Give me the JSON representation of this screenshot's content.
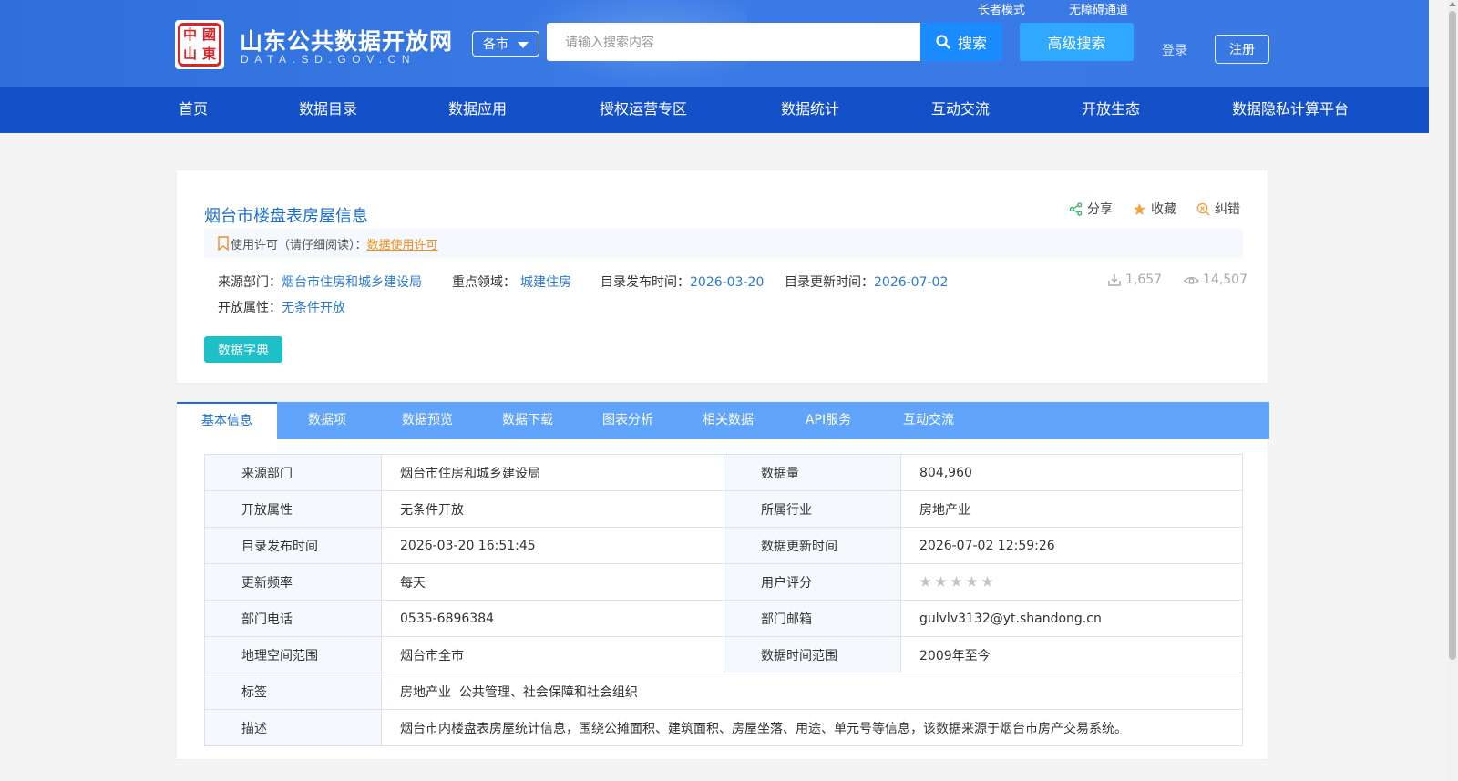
{
  "header": {
    "logo_text": [
      "中",
      "國",
      "山",
      "東"
    ],
    "site_title": "山东公共数据开放网",
    "site_subtitle": "DATA.SD.GOV.CN",
    "region_select": "各市",
    "search_placeholder": "请输入搜索内容",
    "search_button": "搜索",
    "advanced_search": "高级搜索",
    "elder_mode": "长者模式",
    "accessibility": "无障碍通道",
    "login": "登录",
    "register": "注册"
  },
  "nav": [
    "首页",
    "数据目录",
    "数据应用",
    "授权运营专区",
    "数据统计",
    "互动交流",
    "开放生态",
    "数据隐私计算平台"
  ],
  "dataset": {
    "title": "烟台市楼盘表房屋信息",
    "actions": {
      "share": "分享",
      "favorite": "收藏",
      "correct": "纠错"
    },
    "license_prefix": "使用许可（请仔细阅读）：",
    "license_link": "数据使用许可",
    "source_label": "来源部门：",
    "source_value": "烟台市住房和城乡建设局",
    "domain_label": "重点领域：",
    "domain_value": "城建住房",
    "publish_label": "目录发布时间：",
    "publish_value": "2026-03-20",
    "update_label": "目录更新时间：",
    "update_value": "2026-07-02",
    "open_label": "开放属性：",
    "open_value": "无条件开放",
    "downloads": "1,657",
    "views": "14,507",
    "dict_button": "数据字典"
  },
  "tabs": [
    "基本信息",
    "数据项",
    "数据预览",
    "数据下载",
    "图表分析",
    "相关数据",
    "API服务",
    "互动交流"
  ],
  "info_table": {
    "rows": [
      {
        "k1": "来源部门",
        "v1": "烟台市住房和城乡建设局",
        "k2": "数据量",
        "v2": "804,960"
      },
      {
        "k1": "开放属性",
        "v1": "无条件开放",
        "k2": "所属行业",
        "v2": "房地产业"
      },
      {
        "k1": "目录发布时间",
        "v1": "2026-03-20 16:51:45",
        "k2": "数据更新时间",
        "v2": "2026-07-02 12:59:26"
      },
      {
        "k1": "更新频率",
        "v1": "每天",
        "k2": "用户评分",
        "v2": ""
      },
      {
        "k1": "部门电话",
        "v1": "0535-6896384",
        "k2": "部门邮箱",
        "v2": "gulvlv3132@yt.shandong.cn"
      },
      {
        "k1": "地理空间范围",
        "v1": "烟台市全市",
        "k2": "数据时间范围",
        "v2": "2009年至今"
      }
    ],
    "tags_label": "标签",
    "tags_value": "房地产业  公共管理、社会保障和社会组织",
    "desc_label": "描述",
    "desc_value": "烟台市内楼盘表房屋统计信息，围绕公摊面积、建筑面积、房屋坐落、用途、单元号等信息，该数据来源于烟台市房产交易系统。",
    "rating_stars": 0
  },
  "colors": {
    "nav_bg": "#1450c8",
    "tab_bg": "#60a4fb",
    "link_blue": "#1a6fd6",
    "license_orange": "#f08c1d",
    "dict_teal": "#1ec0c7"
  }
}
